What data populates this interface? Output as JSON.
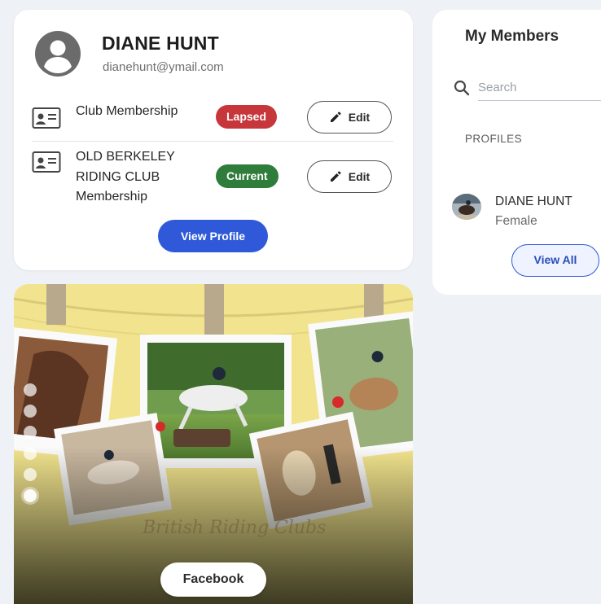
{
  "profile": {
    "name": "DIANE HUNT",
    "email": "dianehunt@ymail.com",
    "view_profile_label": "View Profile"
  },
  "memberships": [
    {
      "label": "Club Membership",
      "status": "Lapsed",
      "edit_label": "Edit"
    },
    {
      "label": "OLD BERKELEY RIDING CLUB Membership",
      "status": "Current",
      "edit_label": "Edit"
    }
  ],
  "banner": {
    "watermark": "British Riding Clubs",
    "facebook_label": "Facebook"
  },
  "members_panel": {
    "title": "My Members",
    "search_placeholder": "Search",
    "section_header": "PROFILES",
    "members": [
      {
        "name": "DIANE HUNT",
        "gender": "Female"
      }
    ],
    "view_all_label": "View All"
  },
  "colors": {
    "lapsed": "#c7363a",
    "current": "#2f7d3a",
    "primary": "#2f59d9"
  }
}
